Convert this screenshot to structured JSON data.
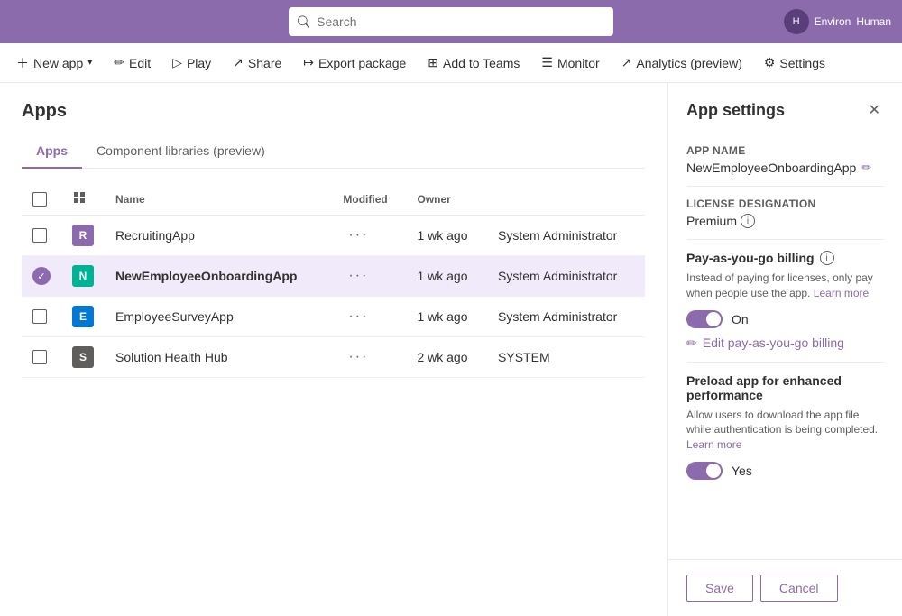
{
  "topbar": {
    "search_placeholder": "Search",
    "env_name": "Environ",
    "user_name": "Human",
    "user_initials": "H"
  },
  "commandbar": {
    "new_app": "New app",
    "edit": "Edit",
    "play": "Play",
    "share": "Share",
    "export_package": "Export package",
    "add_to_teams": "Add to Teams",
    "monitor": "Monitor",
    "analytics": "Analytics (preview)",
    "settings": "Settings"
  },
  "page": {
    "title": "Apps",
    "tabs": [
      {
        "label": "Apps",
        "active": true
      },
      {
        "label": "Component libraries (preview)",
        "active": false
      }
    ]
  },
  "table": {
    "columns": [
      "",
      "Name",
      "",
      "Modified",
      "Owner",
      ""
    ],
    "rows": [
      {
        "id": "row-1",
        "icon_type": "purple",
        "icon_letter": "R",
        "name": "RecruitingApp",
        "modified": "1 wk ago",
        "owner": "System Administrator",
        "selected": false
      },
      {
        "id": "row-2",
        "icon_type": "teal",
        "icon_letter": "N",
        "name": "NewEmployeeOnboardingApp",
        "modified": "1 wk ago",
        "owner": "System Administrator",
        "selected": true
      },
      {
        "id": "row-3",
        "icon_type": "blue",
        "icon_letter": "E",
        "name": "EmployeeSurveyApp",
        "modified": "1 wk ago",
        "owner": "System Administrator",
        "selected": false
      },
      {
        "id": "row-4",
        "icon_type": "gray",
        "icon_letter": "S",
        "name": "Solution Health Hub",
        "modified": "2 wk ago",
        "owner": "SYSTEM",
        "selected": false
      }
    ]
  },
  "app_settings": {
    "title": "App settings",
    "app_name_label": "App name",
    "app_name_value": "NewEmployeeOnboardingApp",
    "license_label": "License designation",
    "license_value": "Premium",
    "billing_title": "Pay-as-you-go billing",
    "billing_desc": "Instead of paying for licenses, only pay when people use the app.",
    "billing_learn_more": "Learn more",
    "toggle_on_label": "On",
    "edit_billing_label": "Edit pay-as-you-go billing",
    "preload_title": "Preload app for enhanced performance",
    "preload_desc": "Allow users to download the app file while authentication is being completed.",
    "preload_learn_more": "Learn more",
    "preload_toggle_label": "Yes",
    "save_btn": "Save",
    "cancel_btn": "Cancel"
  }
}
